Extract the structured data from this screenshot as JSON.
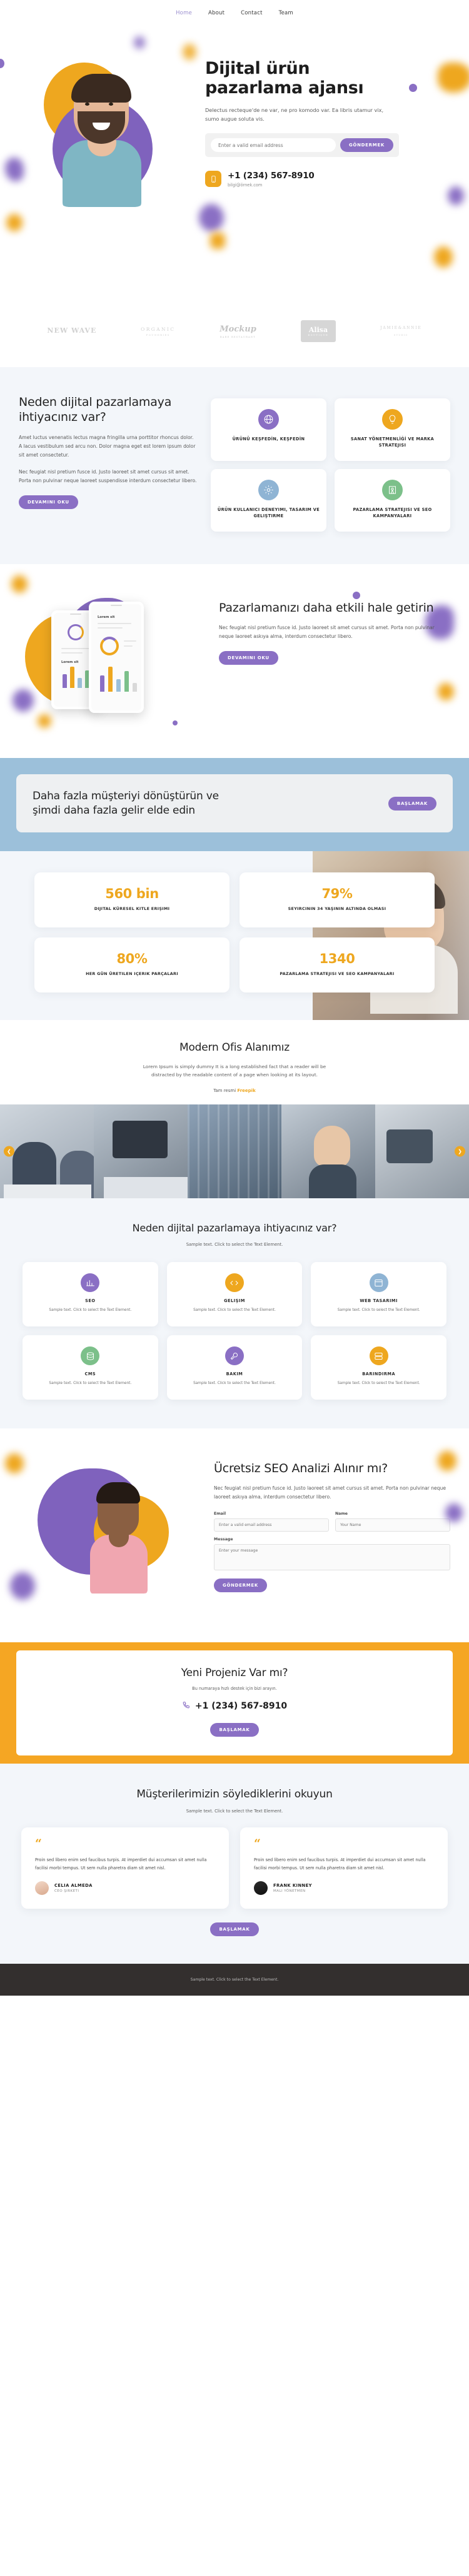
{
  "nav": {
    "items": [
      {
        "label": "Home",
        "active": true
      },
      {
        "label": "About",
        "active": false
      },
      {
        "label": "Contact",
        "active": false
      },
      {
        "label": "Team",
        "active": false
      }
    ]
  },
  "hero": {
    "title": "Dijital ürün pazarlama ajansı",
    "subtitle": "Delectus recteque'de ne var, ne pro komodo var. Ea libris utamur vix, sumo augue soluta vis.",
    "email_placeholder": "Enter a valid email address",
    "submit_label": "GÖNDERMEK",
    "phone": "+1 (234) 567-8910",
    "email": "bilgi@örnek.com",
    "phone_icon": "mobile-phone-icon"
  },
  "logos": [
    {
      "name": "NEW WAVE",
      "sub": ""
    },
    {
      "name": "ORGANIC",
      "sub": "FOUNDRIES"
    },
    {
      "name": "Mockup",
      "sub": "BARE RESTAURANT"
    },
    {
      "name": "Alisa",
      "sub": "BOUTIQUE"
    },
    {
      "name": "JAMIE&ANNIE",
      "sub": "STUDIO"
    }
  ],
  "why": {
    "title": "Neden dijital pazarlamaya ihtiyacınız var?",
    "paragraph1": "Amet luctus venenatis lectus magna fringilla urna porttitor rhoncus dolor. A lacus vestibulum sed arcu non. Dolor magna eget est lorem ipsum dolor sit amet consectetur.",
    "paragraph2": "Nec feugiat nisl pretium fusce id. Justo laoreet sit amet cursus sit amet. Porta non pulvinar neque laoreet suspendisse interdum consectetur libero.",
    "button": "DEVAMINI OKU",
    "cards": [
      {
        "label": "ÜRÜNÜ KEŞFEDİN, KEŞFEDİN",
        "icon": "globe-icon",
        "color": "#8a6fc4"
      },
      {
        "label": "SANAT YÖNETMENLİĞİ VE MARKA STRATEJISI",
        "icon": "lightbulb-icon",
        "color": "#eea71f"
      },
      {
        "label": "ÜRÜN KULLANICI DENEYIMI, TASARIM VE GELIŞTIRME",
        "icon": "gear-icon",
        "color": "#8fb4d4"
      },
      {
        "label": "PAZARLAMA STRATEJISI VE SEO KAMPANYALARI",
        "icon": "map-pin-icon",
        "color": "#7cc08a"
      }
    ]
  },
  "app": {
    "title": "Pazarlamanızı daha etkili hale getirin",
    "paragraph": "Nec feugiat nisl pretium fusce id. Justo laoreet sit amet cursus sit amet. Porta non pulvinar neque laoreet askıya alma, interdum consectetur libero.",
    "button": "DEVAMINI OKU",
    "phone_back_text": "Lorem sit",
    "phone_front_text": "Lorem sit"
  },
  "blue_cta": {
    "title": "Daha fazla müşteriyi dönüştürün ve şimdi daha fazla gelir elde edin",
    "button": "BAŞLAMAK"
  },
  "stats": [
    {
      "value": "560 bin",
      "caption": "DIJITAL KÜRESEL KITLE ERIŞIMI"
    },
    {
      "value": "79%",
      "caption": "SEYIRCININ 34 YAŞININ ALTINDA OLMASI"
    },
    {
      "value": "80%",
      "caption": "HER GÜN ÜRETILEN IÇERIK PARÇALARI"
    },
    {
      "value": "1340",
      "caption": "PAZARLAMA STRATEJISI VE SEO KAMPANYALARI"
    }
  ],
  "office": {
    "title": "Modern Ofis Alanımız",
    "lead": "Lorem Ipsum is simply dummy It is a long established fact that a reader will be distracted by the readable content of a page when looking at its layout.",
    "link_prefix": "Tam resmi",
    "link_text": "Freepik",
    "arrow_left": "left-arrow-icon",
    "arrow_right": "right-arrow-icon"
  },
  "services": {
    "title": "Neden dijital pazarlamaya ihtiyacınız var?",
    "sub": "Sample text. Click to select the Text Element.",
    "cards": [
      {
        "title": "SEO",
        "desc": "Sample text. Click to select the Text Element.",
        "icon": "chart-icon",
        "color": "#8a6fc4"
      },
      {
        "title": "GELIŞIM",
        "desc": "Sample text. Click to select the Text Element.",
        "icon": "code-icon",
        "color": "#eea71f"
      },
      {
        "title": "WEB TASARIMI",
        "desc": "Sample text. Click to select the Text Element.",
        "icon": "layout-icon",
        "color": "#8fb4d4"
      },
      {
        "title": "CMS",
        "desc": "Sample text. Click to select the Text Element.",
        "icon": "database-icon",
        "color": "#7cc08a"
      },
      {
        "title": "BAKIM",
        "desc": "Sample text. Click to select the Text Element.",
        "icon": "wrench-icon",
        "color": "#8a6fc4"
      },
      {
        "title": "BARINDIRMA",
        "desc": "Sample text. Click to select the Text Element.",
        "icon": "server-icon",
        "color": "#eea71f"
      }
    ]
  },
  "seo": {
    "title": "Ücretsiz SEO Analizi Alınır mı?",
    "paragraph": "Nec feugiat nisl pretium fusce id. Justo laoreet sit amet cursus sit amet. Porta non pulvinar neque laoreet askıya alma, interdum consectetur libero.",
    "form": {
      "email_label": "Email",
      "email_placeholder": "Enter a valid email address",
      "name_label": "Name",
      "name_placeholder": "Your Name",
      "message_label": "Message",
      "message_placeholder": "Enter your message",
      "submit_label": "GÖNDERMEK"
    }
  },
  "yellow_cta": {
    "title": "Yeni Projeniz Var mı?",
    "sub": "Bu numaraya hızlı destek için bizi arayın.",
    "phone": "+1 (234) 567-8910",
    "button": "BAŞLAMAK",
    "phone_icon": "phone-icon"
  },
  "testimonials": {
    "title": "Müşterilerimizin söylediklerini okuyun",
    "sub": "Sample text. Click to select the Text Element.",
    "button": "BAŞLAMAK",
    "items": [
      {
        "quote": "Proin sed libero enim sed faucibus turpis. At imperdiet dui accumsan sit amet nulla facilisi morbi tempus. Ut sem nulla pharetra diam sit amet nisl.",
        "name": "CELIA ALMEDA",
        "role": "CEO ŞIRKETI"
      },
      {
        "quote": "Proin sed libero enim sed faucibus turpis. At imperdiet dui accumsan sit amet nulla facilisi morbi tempus. Ut sem nulla pharetra diam sit amet nisl.",
        "name": "FRANK KINNEY",
        "role": "MALI YÖNETMEN"
      }
    ]
  },
  "footer": {
    "text": "Sample text. Click to select the Text Element."
  },
  "colors": {
    "purple": "#8a6fc4",
    "orange": "#eea71f",
    "blue": "#9cc0da",
    "light_bg": "#f3f6fa",
    "dark": "#332f2e"
  }
}
